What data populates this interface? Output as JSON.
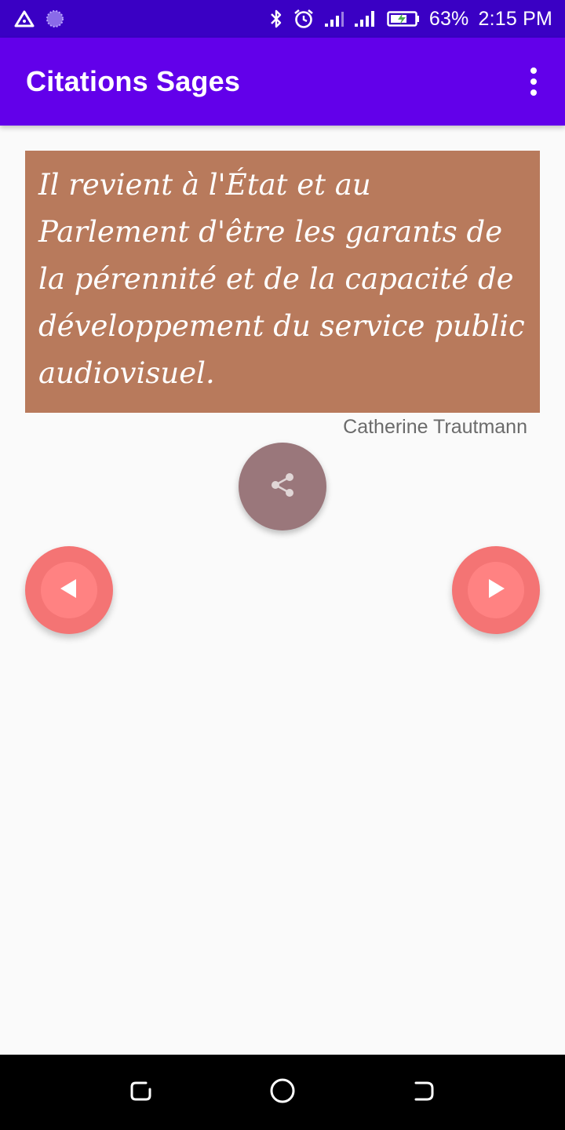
{
  "status_bar": {
    "battery": "63%",
    "time": "2:15 PM",
    "icons": [
      "warning-triangle-icon",
      "notification-circle-icon",
      "bluetooth-icon",
      "alarm-icon",
      "signal-icon",
      "signal-icon",
      "battery-icon"
    ]
  },
  "app_bar": {
    "title": "Citations Sages",
    "menu_icon": "overflow-menu-icon"
  },
  "quote": {
    "text": "Il revient à l'État et au Parlement d'être les garants de la pérennité et de la capacité de développement du service public audiovisuel.",
    "author": "Catherine Trautmann"
  },
  "actions": {
    "share_icon": "share-icon",
    "prev_icon": "play-left-icon",
    "next_icon": "play-right-icon"
  },
  "colors": {
    "status_bar": "#3a00c4",
    "app_bar": "#6200ea",
    "quote_card": "#b87a5c",
    "share_fab": "#9a777b",
    "nav_fab": "#f47474"
  },
  "nav_bar": {
    "icons": [
      "recents-icon",
      "home-icon",
      "back-icon"
    ]
  }
}
